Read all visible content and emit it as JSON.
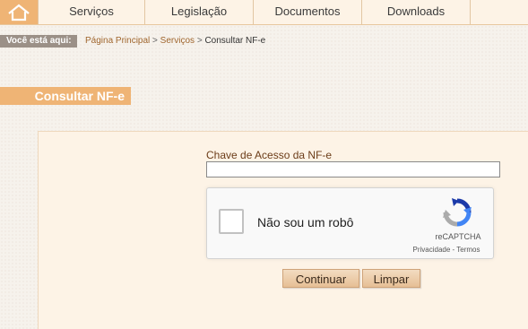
{
  "nav": {
    "home_icon": "home-icon",
    "items": [
      {
        "label": "Serviços"
      },
      {
        "label": "Legislação"
      },
      {
        "label": "Documentos"
      },
      {
        "label": "Downloads"
      }
    ]
  },
  "breadcrumb": {
    "prefix": "Você está aqui:",
    "items": [
      "Página Principal",
      "Serviços",
      "Consultar NF-e"
    ],
    "separator": ">"
  },
  "page": {
    "title": "Consultar NF-e"
  },
  "form": {
    "chave_label": "Chave de Acesso da NF-e",
    "chave_value": "",
    "captcha": {
      "label": "Não sou um robô",
      "brand": "reCAPTCHA",
      "privacy": "Privacidade",
      "link_sep": "-",
      "terms": "Termos",
      "icon": "recaptcha-icon"
    },
    "buttons": {
      "submit": "Continuar",
      "clear": "Limpar"
    }
  },
  "colors": {
    "accent": "#efb475",
    "link": "#a0662e",
    "panel": "#fdf3e6"
  }
}
